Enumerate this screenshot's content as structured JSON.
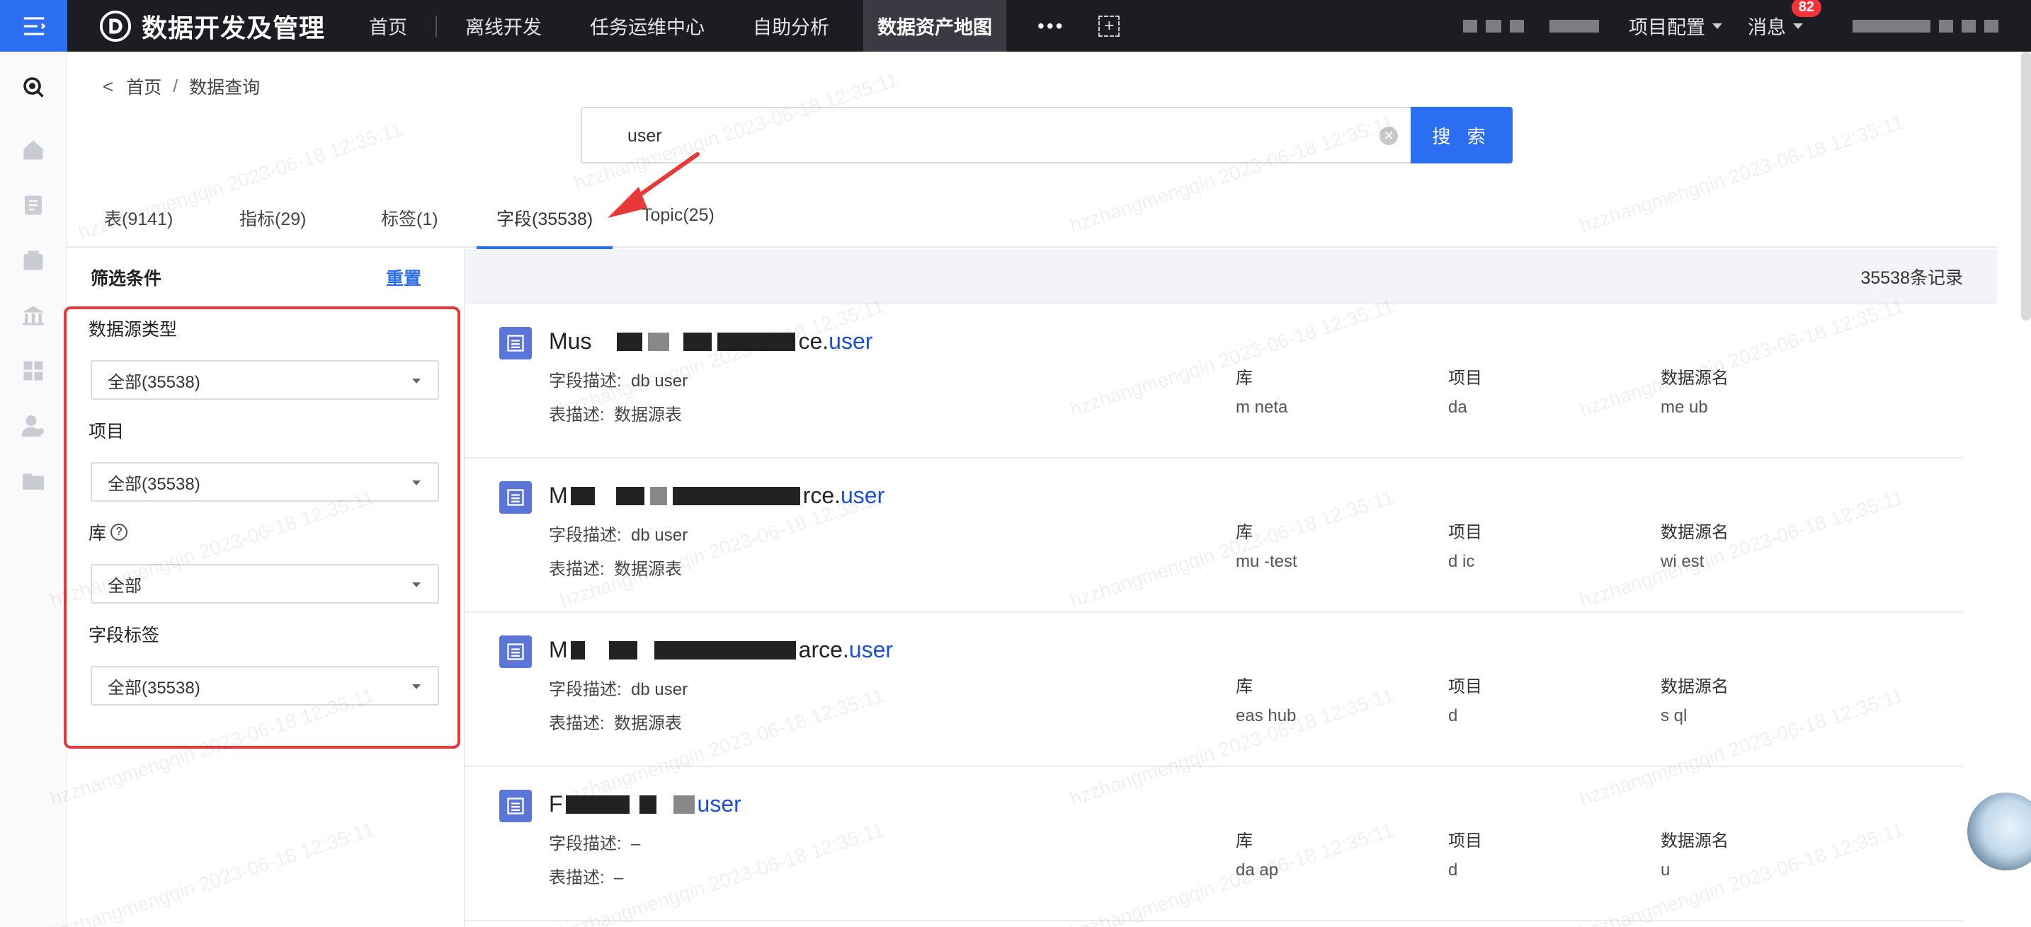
{
  "app": {
    "title": "数据开发及管理",
    "nav": [
      "首页",
      "离线开发",
      "任务运维中心",
      "自助分析",
      "数据资产地图"
    ],
    "active_nav": "数据资产地图",
    "more": "•••",
    "project_config": "项目配置",
    "messages": "消息",
    "message_count": "82"
  },
  "breadcrumb": {
    "home": "首页",
    "current": "数据查询"
  },
  "search": {
    "value": "user",
    "button": "搜 索"
  },
  "tabs": [
    {
      "label": "表(9141)"
    },
    {
      "label": "指标(29)"
    },
    {
      "label": "标签(1)"
    },
    {
      "label": "字段(35538)"
    },
    {
      "label": "Topic(25)"
    }
  ],
  "filter": {
    "title": "筛选条件",
    "reset": "重置",
    "groups": [
      {
        "label": "数据源类型",
        "value": "全部(35538)"
      },
      {
        "label": "项目",
        "value": "全部(35538)"
      },
      {
        "label": "库",
        "value": "全部",
        "help": "?"
      },
      {
        "label": "字段标签",
        "value": "全部(35538)"
      }
    ]
  },
  "results": {
    "count": "35538条记录",
    "labels": {
      "field_desc": "字段描述:",
      "table_desc": "表描述:",
      "db": "库",
      "project": "项目",
      "source": "数据源名"
    },
    "items": [
      {
        "name_prefix": "Mus",
        "name_mid": "ce.",
        "name_hl": "user",
        "field_desc": "db user",
        "table_desc": "数据源表",
        "db": "m          neta",
        "project": "da",
        "source": "me    ub"
      },
      {
        "name_prefix": "M",
        "name_mid": "rce.",
        "name_hl": "user",
        "field_desc": "db user",
        "table_desc": "数据源表",
        "db": "mu            -test",
        "project": "d      ic",
        "source": "wi          est"
      },
      {
        "name_prefix": "M",
        "name_mid": "arce.",
        "name_hl": "user",
        "field_desc": "db user",
        "table_desc": "数据源表",
        "db": "eas        hub",
        "project": "d",
        "source": "s         ql"
      },
      {
        "name_prefix": "F",
        "name_mid": "",
        "name_hl": "user",
        "field_desc": "–",
        "table_desc": "–",
        "db": "da     ap",
        "project": "d",
        "source": "u"
      }
    ]
  },
  "watermark": "hzzhangmengqin 2023-06-18 12:35:11"
}
